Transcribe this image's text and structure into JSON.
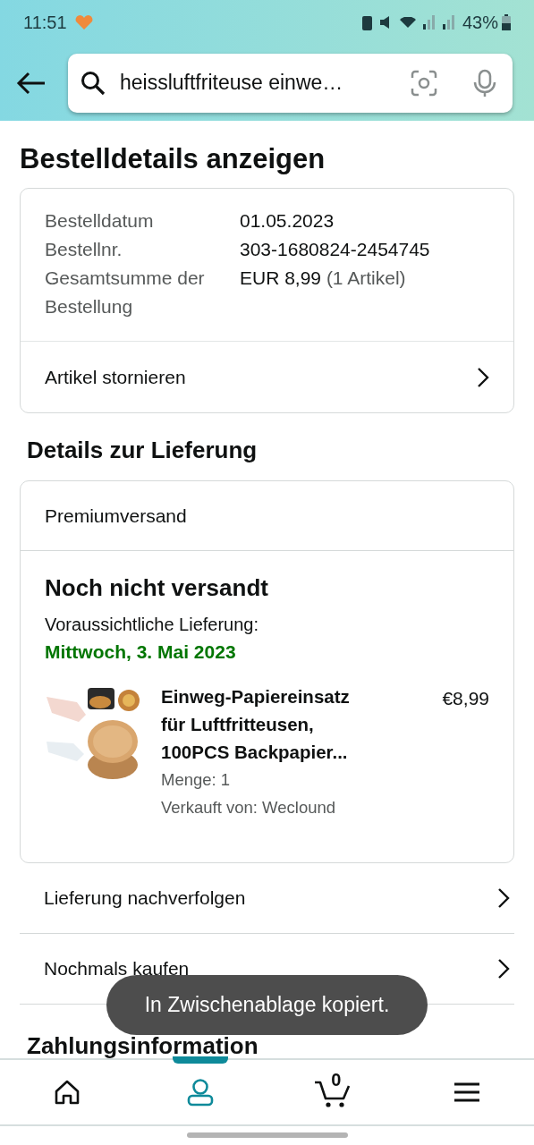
{
  "status_bar": {
    "time": "11:51",
    "battery": "43%"
  },
  "search": {
    "value": "heissluftfriteuse einwe…"
  },
  "title": "Bestelldetails anzeigen",
  "order_summary": {
    "rows": [
      {
        "label": "Bestelldatum",
        "value": "01.05.2023"
      },
      {
        "label": "Bestellnr.",
        "value": "303-1680824-2454745"
      },
      {
        "label": "Gesamtsumme der Bestellung",
        "value": "EUR 8,99",
        "note": "(1 Artikel)"
      }
    ],
    "action": "Artikel stornieren"
  },
  "delivery": {
    "heading": "Details zur Lieferung",
    "shipping": "Premiumversand",
    "status": "Noch nicht versandt",
    "eta_label": "Voraussichtliche Lieferung:",
    "eta": "Mittwoch, 3. Mai 2023",
    "item": {
      "title": "Einweg-Papiereinsatz für Luftfritteusen, 100PCS Backpapier...",
      "price": "€8,99",
      "quantity": "Menge: 1",
      "seller": "Verkauft von: Weclound"
    }
  },
  "actions": [
    "Lieferung nachverfolgen",
    "Nochmals kaufen"
  ],
  "payment_heading": "Zahlungsinformation",
  "toast": "In Zwischenablage kopiert.",
  "nav": [
    {
      "kind": "home",
      "selected": false
    },
    {
      "kind": "account",
      "selected": true
    },
    {
      "kind": "cart",
      "selected": false,
      "count": "0"
    },
    {
      "kind": "menu",
      "selected": false
    }
  ]
}
